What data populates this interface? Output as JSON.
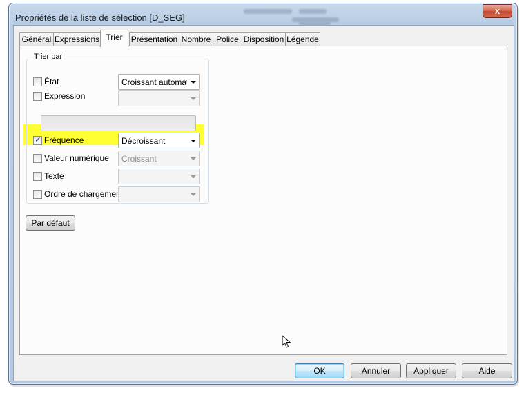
{
  "window": {
    "title": "Propriétés de la liste de sélection [D_SEG]",
    "close_glyph": "x"
  },
  "tabs": [
    {
      "label": "Général"
    },
    {
      "label": "Expressions"
    },
    {
      "label": "Trier"
    },
    {
      "label": "Présentation"
    },
    {
      "label": "Nombre"
    },
    {
      "label": "Police"
    },
    {
      "label": "Disposition"
    },
    {
      "label": "Légende"
    }
  ],
  "active_tab": "Trier",
  "sort": {
    "group_label": "Trier par",
    "rows": [
      {
        "label": "État",
        "checked": false,
        "value": "Croissant automatique",
        "enabled": true
      },
      {
        "label": "Expression",
        "checked": false,
        "value": "",
        "enabled": false
      },
      {
        "label": "Fréquence",
        "checked": true,
        "value": "Décroissant",
        "enabled": true,
        "highlighted": true
      },
      {
        "label": "Valeur numérique",
        "checked": false,
        "value": "Croissant",
        "enabled": false
      },
      {
        "label": "Texte",
        "checked": false,
        "value": "",
        "enabled": false
      },
      {
        "label": "Ordre de chargement",
        "checked": false,
        "value": "",
        "enabled": false
      }
    ],
    "check_mark": "✓",
    "default_button": "Par défaut"
  },
  "footer": {
    "ok": "OK",
    "cancel": "Annuler",
    "apply": "Appliquer",
    "help": "Aide"
  },
  "colors": {
    "highlight": "#ffff33",
    "title_bar": "#b9cde4",
    "close_button": "#c04a30"
  }
}
